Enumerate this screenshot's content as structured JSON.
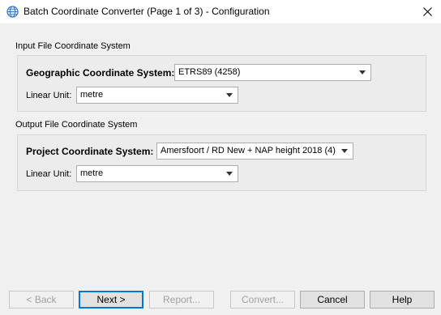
{
  "window": {
    "title": "Batch Coordinate Converter (Page 1 of 3) - Configuration",
    "close_glyph": "×"
  },
  "input_group": {
    "title": "Input File Coordinate System",
    "system_label": "Geographic Coordinate System:",
    "system_value": "ETRS89 (4258)",
    "unit_label": "Linear Unit:",
    "unit_value": "metre"
  },
  "output_group": {
    "title": "Output File Coordinate System",
    "system_label": "Project Coordinate System:",
    "system_value": "Amersfoort / RD New + NAP height 2018 (4)",
    "unit_label": "Linear Unit:",
    "unit_value": "metre"
  },
  "buttons": {
    "back": "< Back",
    "next": "Next >",
    "report": "Report...",
    "convert": "Convert...",
    "cancel": "Cancel",
    "help": "Help"
  },
  "icons": {
    "app": "globe-icon",
    "dropdown": "chevron-down-icon",
    "close": "close-icon"
  },
  "colors": {
    "accent": "#0078d7",
    "icon_blue": "#2a6fc9",
    "disabled_text": "#a0a0a0"
  }
}
